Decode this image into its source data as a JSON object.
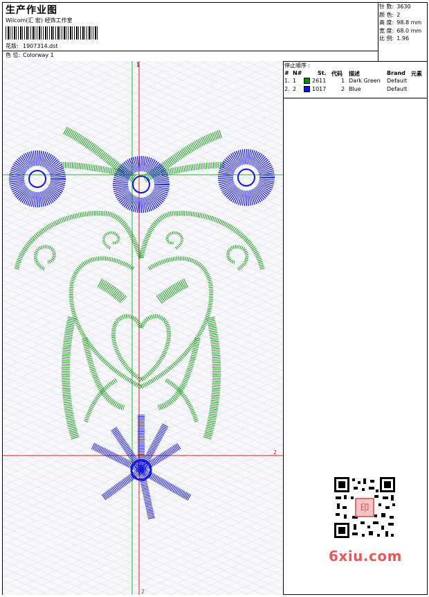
{
  "header": {
    "title": "生产作业图",
    "studio": "Wilcom(汇 宏) 经饰工作室",
    "design_label": "花版:",
    "design_file": "1907314.dst",
    "colorway_label": "色 位:",
    "colorway": "Colorway 1"
  },
  "stats": {
    "stitches_label": "针 数:",
    "stitches": "3630",
    "colors_label": "颜 色:",
    "colors": "2",
    "height_label": "高 度:",
    "height": "98.8 mm",
    "width_label": "宽 度:",
    "width": "68.0 mm",
    "ratio_label": "比 例:",
    "ratio": "1.96"
  },
  "stop_sequence": {
    "title": "停止顺序 :",
    "headers": {
      "num": "#",
      "needle": "N#",
      "st": "St.",
      "code": "代码",
      "desc": "描述",
      "brand": "Brand",
      "element": "元素"
    },
    "rows": [
      {
        "num": "1.",
        "needle": "1",
        "color": "#0a8a0a",
        "st": "2611",
        "code": "1",
        "desc": "Dark Green",
        "brand": "Default"
      },
      {
        "num": "2.",
        "needle": "2",
        "color": "#1010ee",
        "st": "1017",
        "code": "2",
        "desc": "Blue",
        "brand": "Default"
      }
    ]
  },
  "markers": {
    "top_one": "1",
    "right_two": "2",
    "bottom_two": "2"
  },
  "colors": {
    "green": "#1a9a1a",
    "blue": "#1414e0",
    "guide_green": "#22bb22",
    "guide_red": "#cc2222"
  },
  "watermark": "6xiu.com",
  "qr_stamp": "印"
}
